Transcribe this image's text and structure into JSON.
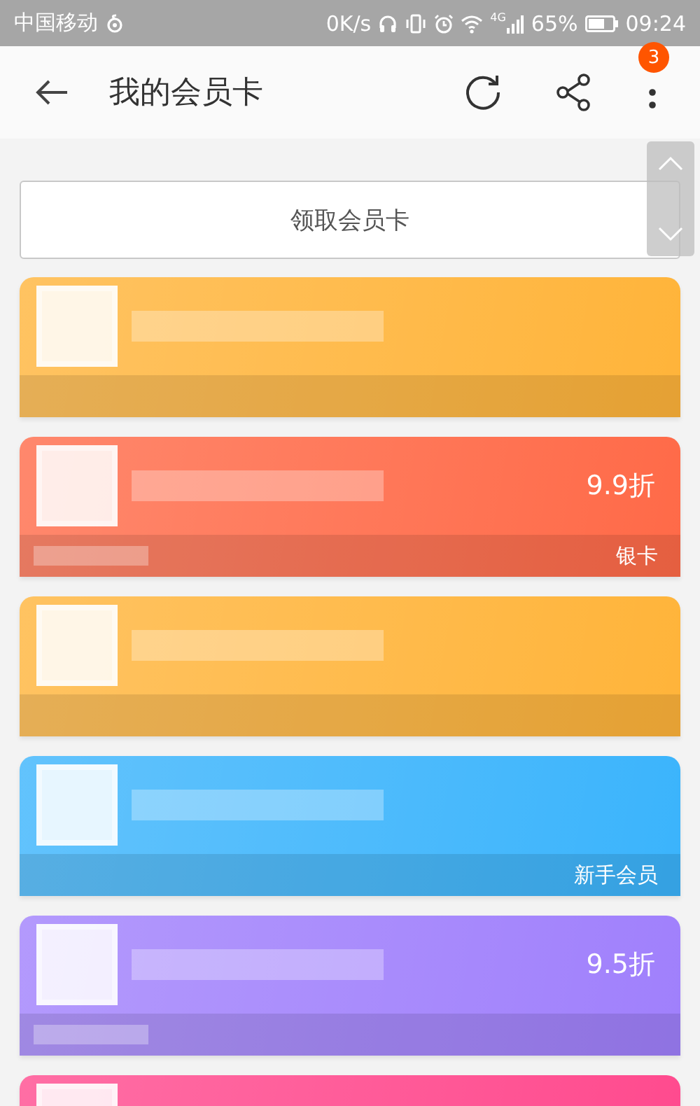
{
  "status_bar": {
    "carrier": "中国移动",
    "speed": "0K/s",
    "network": "4G",
    "battery": "65%",
    "time": "09:24"
  },
  "header": {
    "title": "我的会员卡",
    "badge": "3"
  },
  "claim_button": "领取会员卡",
  "cards": [
    {
      "color": "#ffb43a",
      "footer_blurred": false
    },
    {
      "color": "#ff6a48",
      "discount": "9.9折",
      "tag": "银卡",
      "footer_blurred": true
    },
    {
      "color": "#ffb43a",
      "footer_blurred": false
    },
    {
      "color": "#3bb4fc",
      "tag": "新手会员",
      "footer_blurred": false
    },
    {
      "color": "#a080fc",
      "discount": "9.5折",
      "footer_blurred": true
    },
    {
      "color": "#ff4a8e"
    }
  ]
}
